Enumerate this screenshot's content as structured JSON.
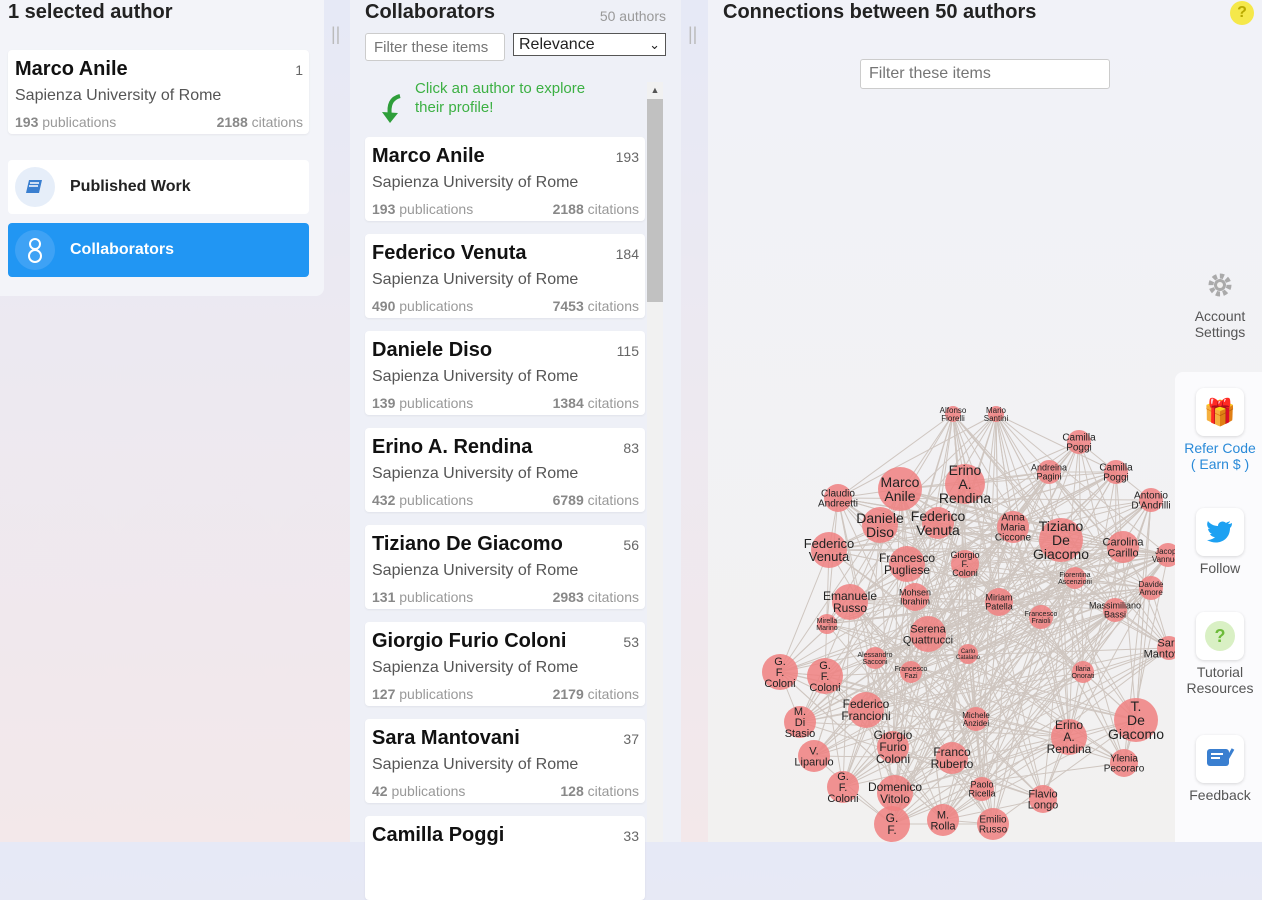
{
  "left": {
    "title": "1 selected author",
    "selected": {
      "name": "Marco Anile",
      "count": "1",
      "affiliation": "Sapienza University of Rome",
      "pubs": "193",
      "pubs_label": "publications",
      "cites": "2188",
      "cites_label": "citations"
    },
    "menu": [
      {
        "label": "Published Work",
        "icon": "book-icon",
        "active": false
      },
      {
        "label": "Collaborators",
        "icon": "people-icon",
        "active": true
      }
    ]
  },
  "mid": {
    "title": "Collaborators",
    "count": "50 authors",
    "filter_placeholder": "Filter these items",
    "sort": "Relevance",
    "hint": [
      "Click an author to explore",
      "their profile!"
    ],
    "authors": [
      {
        "name": "Marco Anile",
        "count": "193",
        "affiliation": "Sapienza University of Rome",
        "pubs": "193",
        "cites": "2188"
      },
      {
        "name": "Federico Venuta",
        "count": "184",
        "affiliation": "Sapienza University of Rome",
        "pubs": "490",
        "cites": "7453"
      },
      {
        "name": "Daniele Diso",
        "count": "115",
        "affiliation": "Sapienza University of Rome",
        "pubs": "139",
        "cites": "1384"
      },
      {
        "name": "Erino A. Rendina",
        "count": "83",
        "affiliation": "Sapienza University of Rome",
        "pubs": "432",
        "cites": "6789"
      },
      {
        "name": "Tiziano De Giacomo",
        "count": "56",
        "affiliation": "Sapienza University of Rome",
        "pubs": "131",
        "cites": "2983"
      },
      {
        "name": "Giorgio Furio Coloni",
        "count": "53",
        "affiliation": "Sapienza University of Rome",
        "pubs": "127",
        "cites": "2179"
      },
      {
        "name": "Sara Mantovani",
        "count": "37",
        "affiliation": "Sapienza University of Rome",
        "pubs": "42",
        "cites": "128"
      },
      {
        "name": "Camilla Poggi",
        "count": "33",
        "affiliation": "",
        "pubs": "",
        "cites": ""
      }
    ],
    "pubs_label": "publications",
    "cites_label": "citations"
  },
  "right": {
    "title": "Connections between 50 authors",
    "filter_placeholder": "Filter these items",
    "help": "?",
    "side_buttons": [
      {
        "label": "Account Settings",
        "icon": "gear-icon"
      },
      {
        "label": "Refer Code ( Earn $ )",
        "icon": "gift-icon"
      },
      {
        "label": "Follow",
        "icon": "twitter-icon"
      },
      {
        "label": "Tutorial Resources",
        "icon": "question-icon"
      },
      {
        "label": "Feedback",
        "icon": "feedback-icon"
      }
    ],
    "nodes": [
      {
        "t": [
          "Alfonso",
          "Fiorelli"
        ]
      },
      {
        "t": [
          "Mario",
          "Santini"
        ]
      },
      {
        "t": [
          "Camilla",
          "Poggi"
        ]
      },
      {
        "t": [
          "Claudio",
          "Andreetti"
        ]
      },
      {
        "t": [
          "Marco",
          "Anile"
        ]
      },
      {
        "t": [
          "Erino",
          "A.",
          "Rendina"
        ]
      },
      {
        "t": [
          "Andreina",
          "Pagini"
        ]
      },
      {
        "t": [
          "Camilla",
          "Poggi"
        ]
      },
      {
        "t": [
          "Antonio",
          "D'Andrilli"
        ]
      },
      {
        "t": [
          "Daniele",
          "Diso"
        ]
      },
      {
        "t": [
          "Federico",
          "Venuta"
        ]
      },
      {
        "t": [
          "Anna",
          "Maria",
          "Ciccone"
        ]
      },
      {
        "t": [
          "Tiziano",
          "De",
          "Giacomo"
        ]
      },
      {
        "t": [
          "Federico",
          "Venuta"
        ]
      },
      {
        "t": [
          "Francesco",
          "Pugliese"
        ]
      },
      {
        "t": [
          "Giorgio",
          "F.",
          "Coloni"
        ]
      },
      {
        "t": [
          "Carolina",
          "Carillo"
        ]
      },
      {
        "t": [
          "Jacopo",
          "Vannucci"
        ]
      },
      {
        "t": [
          "Mohsen",
          "Ibrahim"
        ]
      },
      {
        "t": [
          "Fiorentina",
          "Ascenzioni"
        ]
      },
      {
        "t": [
          "Davide",
          "Amore"
        ]
      },
      {
        "t": [
          "Emanuele",
          "Russo"
        ]
      },
      {
        "t": [
          "Miriam",
          "Patella"
        ]
      },
      {
        "t": [
          "Francesco",
          "Fraioli"
        ]
      },
      {
        "t": [
          "Massimiliano",
          "Bassi"
        ]
      },
      {
        "t": [
          "Mirella",
          "Marino"
        ]
      },
      {
        "t": [
          "Serena",
          "Quattrucci"
        ]
      },
      {
        "t": [
          "Carlo",
          "Catalano"
        ]
      },
      {
        "t": [
          "Sara",
          "Mantovani"
        ]
      },
      {
        "t": [
          "G.",
          "F.",
          "Coloni"
        ]
      },
      {
        "t": [
          "G.",
          "F.",
          "Coloni"
        ]
      },
      {
        "t": [
          "Alessandro",
          "Sacconi"
        ]
      },
      {
        "t": [
          "Francesco",
          "Fazi"
        ]
      },
      {
        "t": [
          "Ilaria",
          "Onorati"
        ]
      },
      {
        "t": [
          "Federico",
          "Francioni"
        ]
      },
      {
        "t": [
          "M.",
          "Di",
          "Stasio"
        ]
      },
      {
        "t": [
          "Michele",
          "Anzidei"
        ]
      },
      {
        "t": [
          "T.",
          "De",
          "Giacomo"
        ]
      },
      {
        "t": [
          "Giorgio",
          "Furio",
          "Coloni"
        ]
      },
      {
        "t": [
          "Erino",
          "A.",
          "Rendina"
        ]
      },
      {
        "t": [
          "V.",
          "Liparulo"
        ]
      },
      {
        "t": [
          "Franco",
          "Ruberto"
        ]
      },
      {
        "t": [
          "Ylenia",
          "Pecoraro"
        ]
      },
      {
        "t": [
          "G.",
          "F.",
          "Coloni"
        ]
      },
      {
        "t": [
          "Domenico",
          "Vitolo"
        ]
      },
      {
        "t": [
          "Paolo",
          "Ricella"
        ]
      },
      {
        "t": [
          "Flavio",
          "Longo"
        ]
      },
      {
        "t": [
          "G.",
          "F."
        ]
      },
      {
        "t": [
          "M.",
          "Rolla"
        ]
      },
      {
        "t": [
          "Emilio",
          "Russo"
        ]
      }
    ]
  }
}
